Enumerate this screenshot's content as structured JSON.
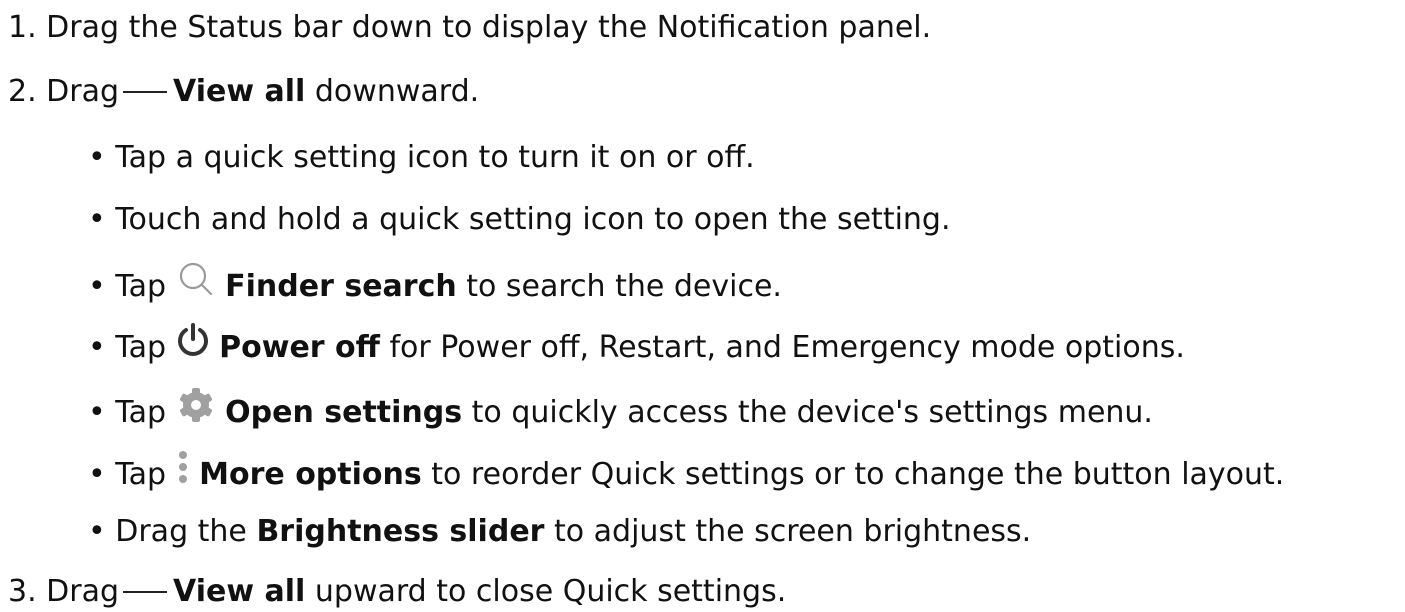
{
  "steps": [
    {
      "number": "1.",
      "text": "Drag the Status bar down to display the Notification panel."
    },
    {
      "number": "2.",
      "pre": "Drag",
      "bold": "View all",
      "post": "downward.",
      "icon": "dash-line"
    },
    {
      "number": "3.",
      "pre": "Drag",
      "bold": "View all",
      "post": "upward to close Quick settings.",
      "icon": "dash-line"
    }
  ],
  "bullets": [
    {
      "marker": "•",
      "text": "Tap a quick setting icon to turn it on or off."
    },
    {
      "marker": "•",
      "text": "Touch and hold a quick setting icon to open the setting."
    },
    {
      "marker": "•",
      "pre": "Tap",
      "icon": "search-icon",
      "bold": "Finder search",
      "post": "to search the device."
    },
    {
      "marker": "•",
      "pre": "Tap",
      "icon": "power-icon",
      "bold": "Power off",
      "post": "for Power off, Restart, and Emergency mode options."
    },
    {
      "marker": "•",
      "pre": "Tap",
      "icon": "gear-icon",
      "bold": "Open settings",
      "post": "to quickly access the device's settings menu."
    },
    {
      "marker": "•",
      "pre": "Tap",
      "icon": "more-options-icon",
      "bold": "More options",
      "post": "to reorder Quick settings or to change the button layout."
    },
    {
      "marker": "•",
      "pre": "Drag the",
      "bold": "Brightness slider",
      "post": "to adjust the screen brightness."
    }
  ],
  "colors": {
    "text": "#111111",
    "icon_light": "#9a9a9a",
    "icon_dark": "#333333"
  }
}
